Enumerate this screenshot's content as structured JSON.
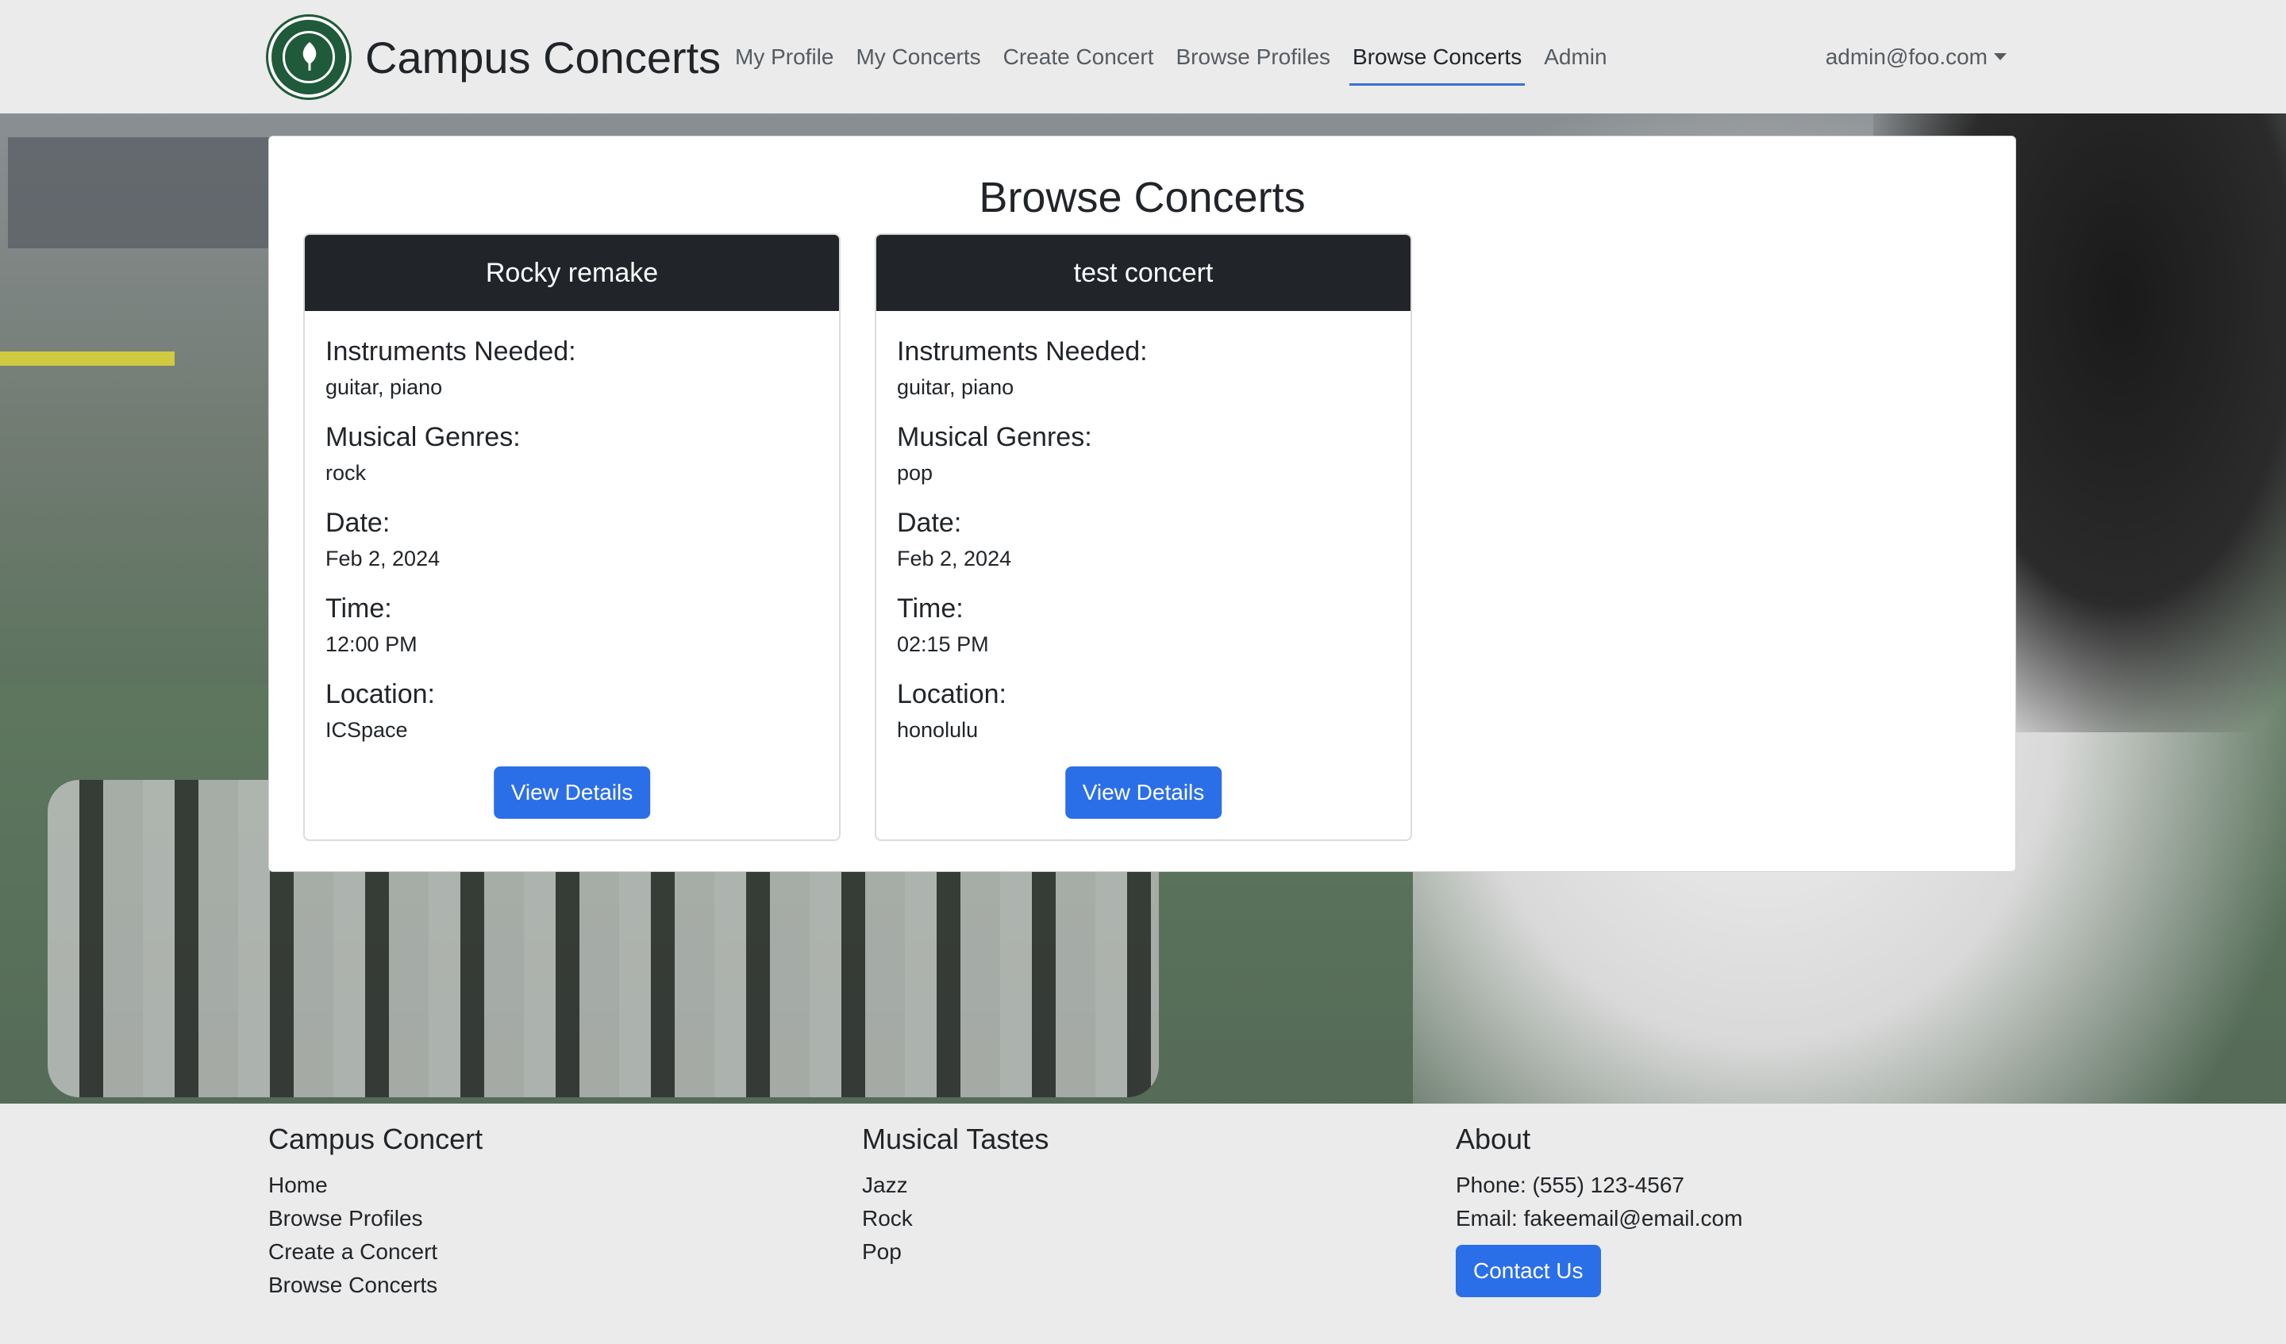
{
  "nav": {
    "brand": "Campus Concerts",
    "links": [
      "My Profile",
      "My Concerts",
      "Create Concert",
      "Browse Profiles",
      "Browse Concerts",
      "Admin"
    ],
    "active": "Browse Concerts",
    "user": "admin@foo.com"
  },
  "main": {
    "title": "Browse Concerts",
    "labels": {
      "instruments": "Instruments Needed:",
      "genres": "Musical Genres:",
      "date": "Date:",
      "time": "Time:",
      "location": "Location:"
    },
    "button_label": "View Details",
    "concerts": [
      {
        "name": "Rocky remake",
        "instruments": "guitar, piano",
        "genres": "rock",
        "date": "Feb 2, 2024",
        "time": "12:00 PM",
        "location": "ICSpace"
      },
      {
        "name": "test concert",
        "instruments": "guitar, piano",
        "genres": "pop",
        "date": "Feb 2, 2024",
        "time": "02:15 PM",
        "location": "honolulu"
      }
    ]
  },
  "footer": {
    "col1": {
      "heading": "Campus Concert",
      "links": [
        "Home",
        "Browse Profiles",
        "Create a Concert",
        "Browse Concerts"
      ]
    },
    "col2": {
      "heading": "Musical Tastes",
      "links": [
        "Jazz",
        "Rock",
        "Pop"
      ]
    },
    "col3": {
      "heading": "About",
      "phone": "Phone: (555) 123-4567",
      "email": "Email: fakeemail@email.com",
      "button": "Contact Us"
    }
  },
  "colors": {
    "accent": "#2b6fe8",
    "card_header": "#212529",
    "active_underline": "#3a6fd8",
    "seal": "#1f5a3a"
  }
}
